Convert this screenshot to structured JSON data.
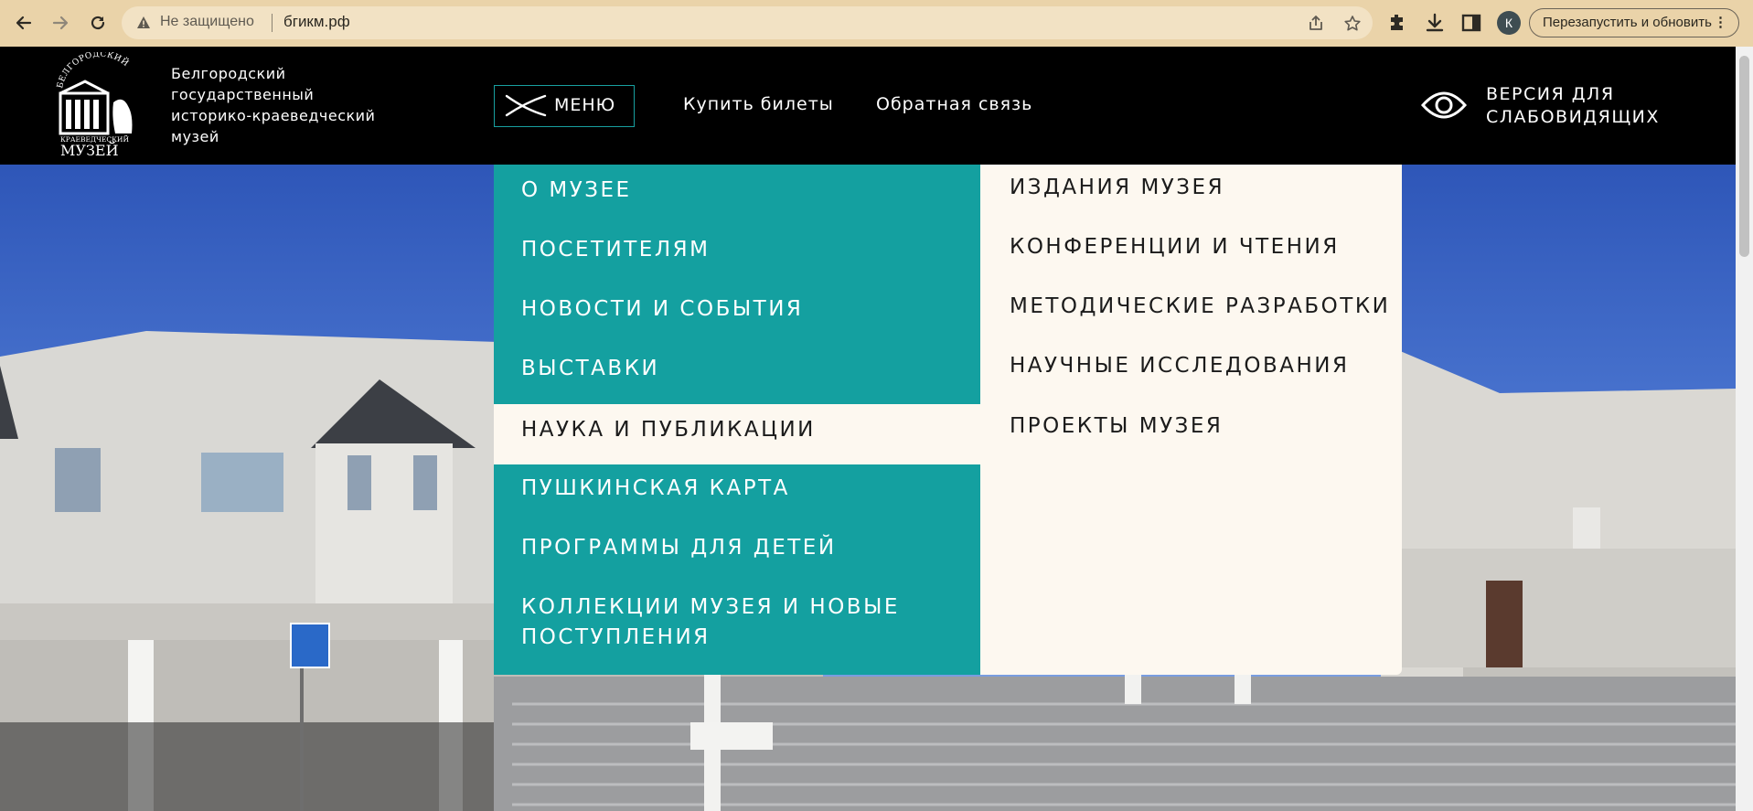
{
  "browser": {
    "security_label": "Не защищено",
    "url": "бгикм.рф",
    "relaunch_label": "Перезапустить и обновить",
    "avatar_letter": "К"
  },
  "header": {
    "museum_name": [
      "Белгородский",
      "государственный",
      "историко-краеведческий",
      "музей"
    ],
    "logo_text_top": "БЕЛГОРОДСКИЙ",
    "logo_text_mid": "КРАЕВЕДЧЕСКИЙ",
    "logo_text_bottom": "МУЗЕЙ",
    "menu_label": "МЕНЮ",
    "buy_tickets": "Купить билеты",
    "feedback": "Обратная связь",
    "low_vision_line1": "ВЕРСИЯ ДЛЯ",
    "low_vision_line2": "СЛАБОВИДЯЩИХ"
  },
  "menu": {
    "left_items": [
      "О МУЗЕЕ",
      "ПОСЕТИТЕЛЯМ",
      "НОВОСТИ И СОБЫТИЯ",
      "ВЫСТАВКИ",
      "НАУКА И ПУБЛИКАЦИИ",
      "ПУШКИНСКАЯ КАРТА",
      "ПРОГРАММЫ ДЛЯ ДЕТЕЙ",
      "КОЛЛЕКЦИИ МУЗЕЯ И НОВЫЕ",
      "ПОСТУПЛЕНИЯ"
    ],
    "active_item": "НАУКА И ПУБЛИКАЦИИ",
    "right_items": [
      "ИЗДАНИЯ МУЗЕЯ",
      "КОНФЕРЕНЦИИ И ЧТЕНИЯ",
      "МЕТОДИЧЕСКИЕ РАЗРАБОТКИ",
      "НАУЧНЫЕ ИССЛЕДОВАНИЯ",
      "ПРОЕКТЫ МУЗЕЯ"
    ]
  },
  "colors": {
    "menu_teal": "#14a0a0",
    "menu_cream": "#fdf8f0",
    "header_black": "#000000",
    "chrome_bar": "#ead3a9"
  }
}
